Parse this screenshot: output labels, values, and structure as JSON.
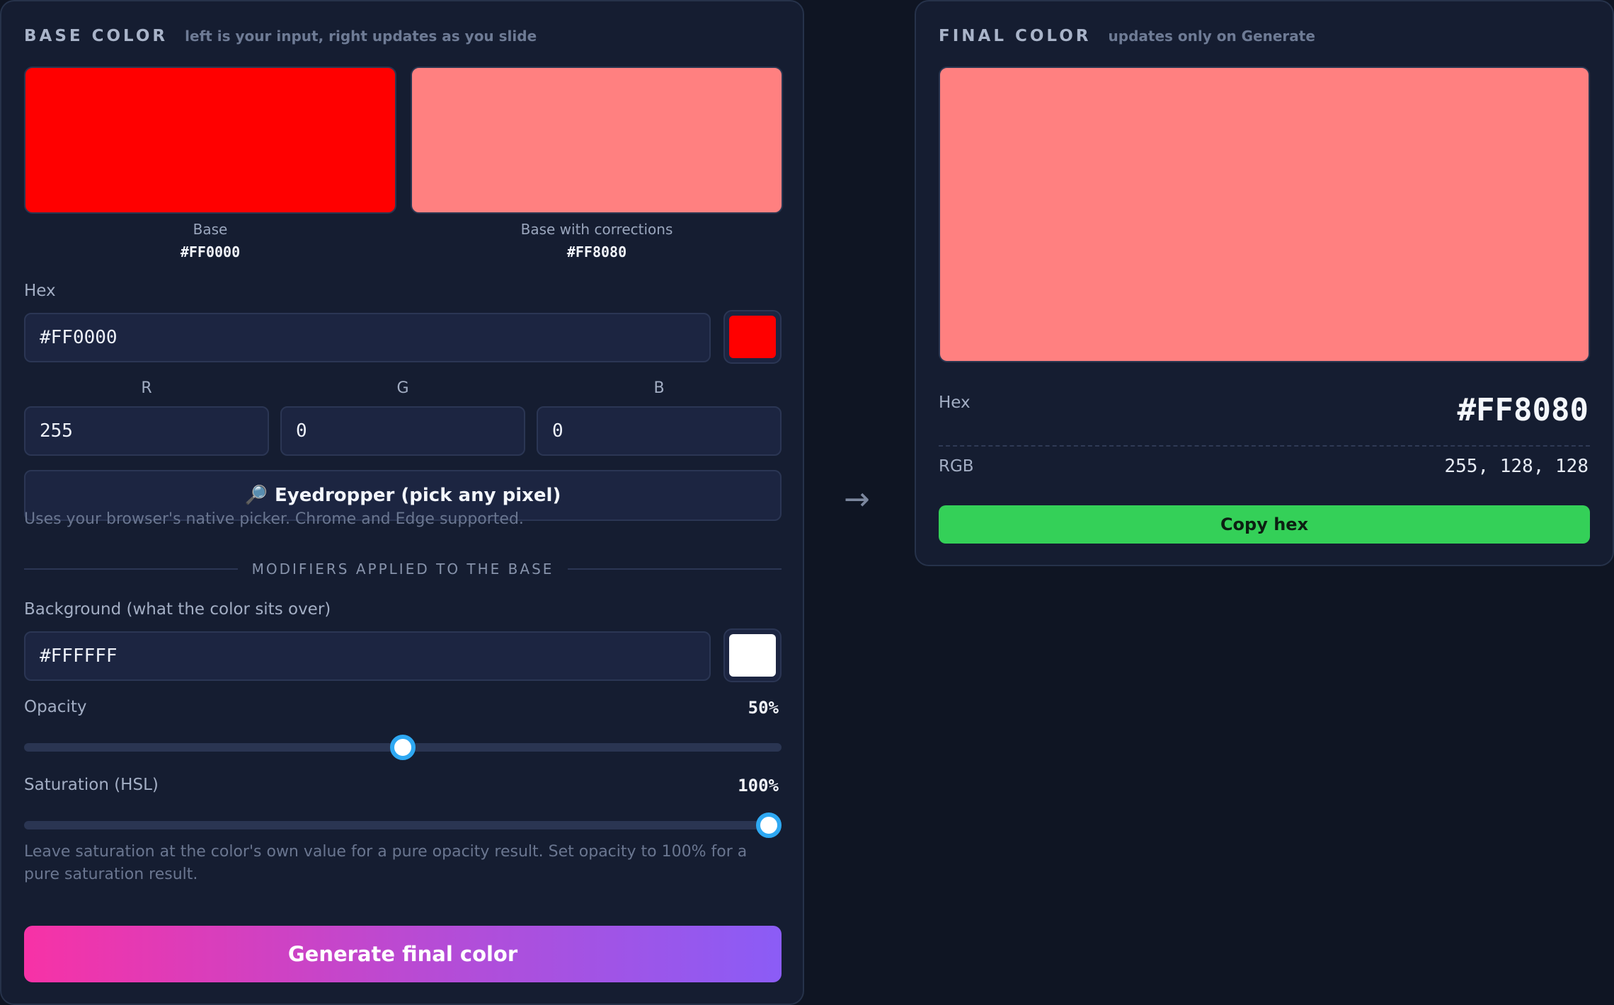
{
  "base_panel": {
    "title": "BASE COLOR",
    "subtitle": "left is your input, right updates as you slide",
    "swatches": [
      {
        "caption": "Base",
        "hex": "#FF0000",
        "color": "#FF0000"
      },
      {
        "caption": "Base with corrections",
        "hex": "#FF8080",
        "color": "#FF8080"
      }
    ],
    "hex_label": "Hex",
    "hex_value": "#FF0000",
    "hex_picker_color": "#FF0000",
    "rgb": {
      "r_label": "R",
      "g_label": "G",
      "b_label": "B",
      "r": "255",
      "g": "0",
      "b": "0"
    },
    "eyedropper_label": "Eyedropper (pick any pixel)",
    "eyedropper_icon": "magnifier-icon",
    "eyedropper_hint": "Uses your browser's native picker. Chrome and Edge supported.",
    "modifiers_heading": "MODIFIERS APPLIED TO THE BASE",
    "background_label": "Background (what the color sits over)",
    "background_value": "#FFFFFF",
    "background_picker_color": "#FFFFFF",
    "opacity_label": "Opacity",
    "opacity_text": "50%",
    "opacity_value": 50,
    "saturation_label": "Saturation (HSL)",
    "saturation_text": "100%",
    "saturation_value": 100,
    "saturation_hint": "Leave saturation at the color's own value for a pure opacity result. Set opacity to 100% for a pure saturation result.",
    "generate_label": "Generate final color"
  },
  "arrow_icon": "arrow-right-icon",
  "arrow_glyph": "→",
  "final_panel": {
    "title": "FINAL COLOR",
    "subtitle": "updates only on Generate",
    "color": "#FF8080",
    "hex_label": "Hex",
    "hex_value": "#FF8080",
    "rgb_label": "RGB",
    "rgb_value": "255, 128, 128",
    "copy_label": "Copy hex"
  },
  "colors": {
    "accent_blue": "#2EA8F2",
    "copy_green": "#34D058",
    "gradient_start": "#F732A6",
    "gradient_end": "#8B5CF6"
  }
}
